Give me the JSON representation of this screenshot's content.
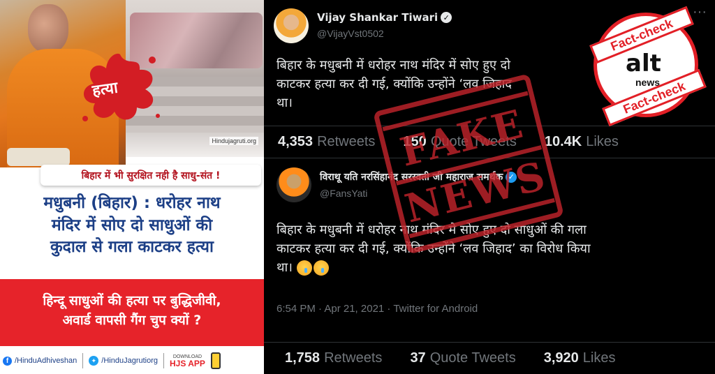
{
  "poster": {
    "blood_label": "हत्या",
    "watermark": "Hindujagruti.org",
    "subheadline": "बिहार में भी सुरक्षित नही है साधु-संत !",
    "headline_lines": [
      "मधुबनी (बिहार) : धरोहर नाथ",
      "मंदिर में सोए दो साधुओं की",
      "कुदाल से गला काटकर हत्या"
    ],
    "question_lines": [
      "हिन्दू साधुओं की हत्या पर बुद्धिजीवी,",
      "अवार्ड वापसी गैंग चुप क्यों ?"
    ],
    "footer": {
      "facebook": "/HinduAdhiveshan",
      "twitter": "/HinduJagrutiorg",
      "download": "DOWNLOAD",
      "app": "HJS APP"
    }
  },
  "tweet1": {
    "display_name": "Vijay Shankar Tiwari",
    "handle": "@VijayVst0502",
    "text_lines": [
      "बिहार के मधुबनी में धरोहर नाथ मंदिर में सोए हुए दो",
      "काटकर हत्या कर दी गई, क्योंकि उन्होंने ‘लव जिहाद",
      "था।"
    ],
    "retweets": "4,353",
    "retweets_label": "Retweets",
    "quotes": "150",
    "quotes_label": "Quote Tweets",
    "likes": "10.4K",
    "likes_label": "Likes"
  },
  "tweet2": {
    "display_name": "विराथू यति नरसिंहानंद सरस्वती जी महाराज समर्थक",
    "handle": "@FansYati",
    "text_lines": [
      "बिहार के मधुबनी में धरोहर नाथ मंदिर मे सोए हुए दो साधुओं की गला",
      "काटकर हत्या कर दी गई, क्योंकि उन्होंने ‘लव जिहाद’ का विरोध किया",
      "था।"
    ],
    "timestamp": "6:54 PM · Apr 21, 2021 · Twitter for Android",
    "retweets": "1,758",
    "retweets_label": "Retweets",
    "quotes": "37",
    "quotes_label": "Quote Tweets",
    "likes": "3,920",
    "likes_label": "Likes"
  },
  "stamp": {
    "line1": "FAKE",
    "line2": "NEWS",
    "color": "#c0242b"
  },
  "badge": {
    "top": "Fact-check",
    "bottom": "Fact-check",
    "logo": "alt",
    "sub": "news",
    "color": "#e21f26"
  }
}
